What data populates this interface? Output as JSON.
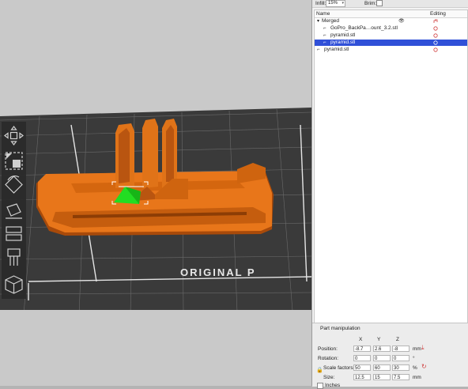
{
  "viewport": {
    "bed_label": "ORIGINAL P",
    "tools": [
      "move-tool",
      "scale-tool",
      "rotate-tool",
      "place-on-face-tool",
      "cut-tool",
      "paint-support-tool",
      "seam-tool",
      "view-cube-tool"
    ]
  },
  "settings": {
    "infill_label": "Infill:",
    "infill_value": "15%",
    "brim_label": "Brim:"
  },
  "object_list": {
    "col_name": "Name",
    "col_editing": "Editing",
    "items": [
      {
        "label": "Merged",
        "indent": 0,
        "selected": false
      },
      {
        "label": "GoPro_BackPa…ount_3.2.stl",
        "indent": 1,
        "selected": false
      },
      {
        "label": "pyramid.stl",
        "indent": 1,
        "selected": false
      },
      {
        "label": "pyramid.stl",
        "indent": 1,
        "selected": true
      },
      {
        "label": "pyramid.stl",
        "indent": 0,
        "selected": false
      }
    ]
  },
  "part_manipulation": {
    "title": "Part manipulation",
    "axis_x": "X",
    "axis_y": "Y",
    "axis_z": "Z",
    "position_label": "Position:",
    "position": [
      "-8.7",
      "2.6",
      "-8"
    ],
    "position_unit": "mm",
    "rotation_label": "Rotation:",
    "rotation": [
      "0",
      "0",
      "0"
    ],
    "rotation_unit": "°",
    "scale_label": "Scale factors:",
    "scale": [
      "50",
      "60",
      "30"
    ],
    "scale_unit": "%",
    "size_label": "Size:",
    "size": [
      "12.5",
      "15",
      "7.5"
    ],
    "size_unit": "mm",
    "inches_label": "Inches"
  },
  "colors": {
    "model": "#e8761a",
    "selected_part": "#22dd22",
    "selection_row": "#3050d8",
    "bed": "#3a3a3a"
  }
}
